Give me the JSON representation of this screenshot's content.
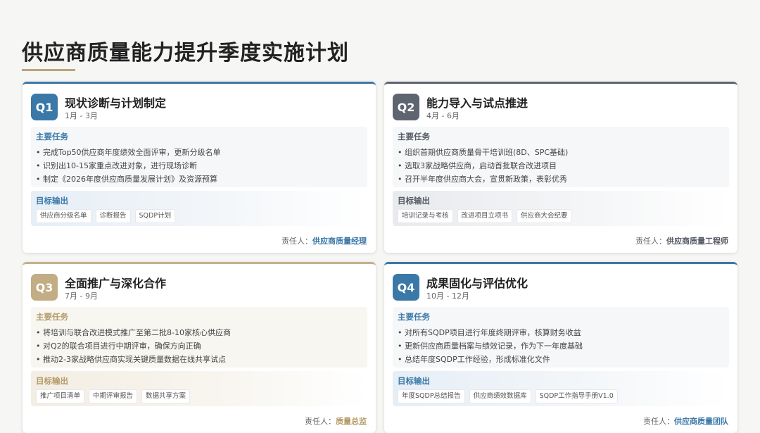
{
  "page": {
    "title": "供应商质量能力提升季度实施计划"
  },
  "colors": {
    "blue": "#3a78a8",
    "slate": "#5e6470",
    "gold": "#c2ad84"
  },
  "quarters": [
    {
      "badge": "Q1",
      "title": "现状诊断与计划制定",
      "months": "1月 - 3月",
      "tasks_label": "主要任务",
      "tasks": [
        "• 完成Top50供应商年度绩效全面评审，更新分级名单",
        "• 识别出10-15家重点改进对象，进行现场诊断",
        "• 制定《2026年度供应商质量发展计划》及资源预算"
      ],
      "output_label": "目标输出",
      "outputs": [
        "供应商分级名单",
        "诊断报告",
        "SQDP计划"
      ],
      "owner_label": "责任人：",
      "owner": "供应商质量经理"
    },
    {
      "badge": "Q2",
      "title": "能力导入与试点推进",
      "months": "4月 - 6月",
      "tasks_label": "主要任务",
      "tasks": [
        "• 组织首期供应商质量骨干培训班(8D、SPC基础)",
        "• 选取3家战略供应商，启动首批联合改进项目",
        "• 召开半年度供应商大会，宣贯新政策，表彰优秀"
      ],
      "output_label": "目标输出",
      "outputs": [
        "培训记录与考核",
        "改进项目立项书",
        "供应商大会纪要"
      ],
      "owner_label": "责任人：",
      "owner": "供应商质量工程师"
    },
    {
      "badge": "Q3",
      "title": "全面推广与深化合作",
      "months": "7月 - 9月",
      "tasks_label": "主要任务",
      "tasks": [
        "• 将培训与联合改进模式推广至第二批8-10家核心供应商",
        "• 对Q2的联合项目进行中期评审，确保方向正确",
        "• 推动2-3家战略供应商实现关键质量数据在线共享试点"
      ],
      "output_label": "目标输出",
      "outputs": [
        "推广项目清单",
        "中期评审报告",
        "数据共享方案"
      ],
      "owner_label": "责任人：",
      "owner": "质量总监"
    },
    {
      "badge": "Q4",
      "title": "成果固化与评估优化",
      "months": "10月 - 12月",
      "tasks_label": "主要任务",
      "tasks": [
        "• 对所有SQDP项目进行年度终期评审，核算财务收益",
        "• 更新供应商质量档案与绩效记录，作为下一年度基础",
        "• 总结年度SQDP工作经验，形成标准化文件"
      ],
      "output_label": "目标输出",
      "outputs": [
        "年度SQDP总结报告",
        "供应商绩效数据库",
        "SQDP工作指导手册V1.0"
      ],
      "owner_label": "责任人：",
      "owner": "供应商质量团队"
    }
  ]
}
